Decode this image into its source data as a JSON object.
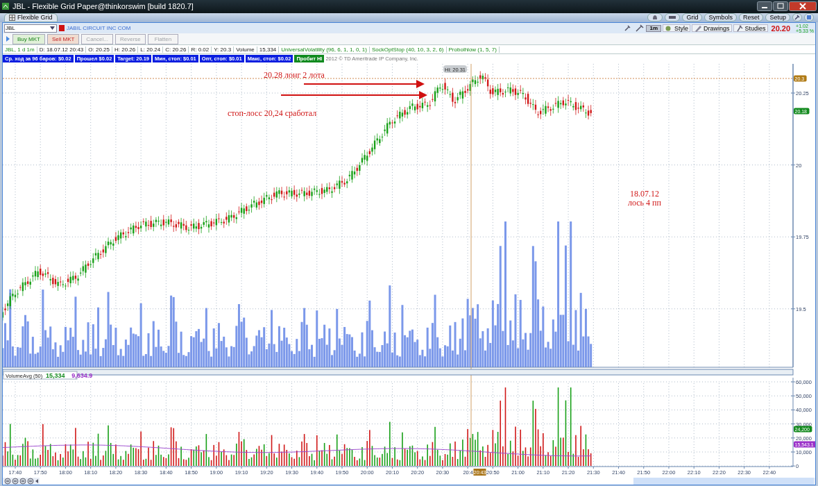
{
  "window": {
    "title": "JBL - Flexible Grid Paper@thinkorswim [build 1820.7]"
  },
  "tab": {
    "label": "Flexible Grid"
  },
  "top_buttons": [
    {
      "kind": "icon"
    },
    {
      "kind": "icon"
    },
    {
      "kind": "text",
      "label": "Grid"
    },
    {
      "kind": "text",
      "label": "Symbols"
    },
    {
      "kind": "text",
      "label": "Reset"
    },
    {
      "kind": "text",
      "label": "Setup"
    },
    {
      "kind": "icon"
    },
    {
      "kind": "icon"
    }
  ],
  "symbol": {
    "value": "JBL",
    "description": "JABIL CIRCUIT INC COM"
  },
  "order_buttons": [
    {
      "label": "Buy MKT",
      "kind": "buy",
      "disabled": false
    },
    {
      "label": "Sell MKT",
      "kind": "sell",
      "disabled": false
    },
    {
      "label": "Cancel...",
      "kind": "plain",
      "disabled": true
    },
    {
      "label": "Reverse",
      "kind": "plain",
      "disabled": true
    },
    {
      "label": "Flatten",
      "kind": "plain",
      "disabled": true
    }
  ],
  "chart_toolbar": {
    "timeframe": "1m",
    "buttons": [
      "Style",
      "Drawings",
      "Studies"
    ],
    "last_price": "20.20",
    "change": "+1.02",
    "change_pct": "+5.33 %"
  },
  "header_cells": [
    {
      "text": "JBL, 1 d 1m",
      "kind": "symbol"
    },
    {
      "text": "D: 18.07.12 20:43",
      "kind": "value"
    },
    {
      "text": "O: 20.25",
      "kind": "value"
    },
    {
      "text": "H: 20.26",
      "kind": "value"
    },
    {
      "text": "L: 20.24",
      "kind": "value"
    },
    {
      "text": "C: 20.26",
      "kind": "value"
    },
    {
      "text": "R: 0.02",
      "kind": "value"
    },
    {
      "text": "Y: 20.3",
      "kind": "value"
    },
    {
      "text": "Volume",
      "kind": "value"
    },
    {
      "text": "15,334",
      "kind": "value"
    },
    {
      "text": "UniversalVolatility (96, 6, 1, 1, 0, 1)",
      "kind": "study"
    },
    {
      "text": "SockOptStop (40, 10, 3, 2, 6)",
      "kind": "study"
    },
    {
      "text": "Probolhlow (1, 5, 7)",
      "kind": "study"
    }
  ],
  "badges": [
    {
      "text": "Ср. ход за 96 баров: $0.02",
      "color": "#0a1ee0"
    },
    {
      "text": "Прошел $0.02",
      "color": "#0a1ee0"
    },
    {
      "text": "Target: 20.19",
      "color": "#0a1ee0"
    },
    {
      "text": "Мин, стоп: $0.01",
      "color": "#0a1ee0"
    },
    {
      "text": "Опт, стоп: $0.01",
      "color": "#0a1ee0"
    },
    {
      "text": "Макс, стоп: $0.02",
      "color": "#0a1ee0"
    },
    {
      "text": "Пробит Hl",
      "color": "#0f8a1e"
    }
  ],
  "copyright": "2012 © TD Ameritrade IP Company, Inc.",
  "price_axis": {
    "ticks": [
      "20.25",
      "20",
      "19.75",
      "19.5"
    ]
  },
  "price_markers": [
    {
      "text": "20.3",
      "color": "#b07a14"
    },
    {
      "text": "20.18",
      "color": "#138a1e"
    }
  ],
  "hi_label": "Hi: 20.31",
  "annotations": [
    {
      "text": "20.28 лонг 2 лота"
    },
    {
      "text": "стоп-лосс 20,24 сработал"
    },
    {
      "text": "18.07.12"
    },
    {
      "text": "лось 4 пп"
    }
  ],
  "volume_study": {
    "name": "VolumeAvg (50)",
    "values": [
      {
        "text": "15,334",
        "color": "#138a1e"
      },
      {
        "text": "9,634.9",
        "color": "#9a30c8"
      }
    ]
  },
  "volume_axis": {
    "ticks": [
      "60,000",
      "50,000",
      "40,000",
      "30,000",
      "20,000",
      "10,000",
      "0"
    ]
  },
  "volume_markers": [
    {
      "text": "24,200",
      "color": "#138a1e"
    },
    {
      "text": "15,543.1",
      "color": "#9a30c8"
    }
  ],
  "time_axis": {
    "ticks": [
      "17:40",
      "17:50",
      "18:00",
      "18:10",
      "18:20",
      "18:30",
      "18:40",
      "18:50",
      "19:00",
      "19:10",
      "19:20",
      "19:30",
      "19:40",
      "19:50",
      "20:00",
      "20:10",
      "20:20",
      "20:30",
      "20:4",
      "20:50",
      "21:00",
      "21:10",
      "21:20",
      "21:30",
      "21:40",
      "21:50",
      "22:00",
      "22:10",
      "22:20",
      "22:30",
      "22:40"
    ],
    "cursor": "20:43"
  }
}
